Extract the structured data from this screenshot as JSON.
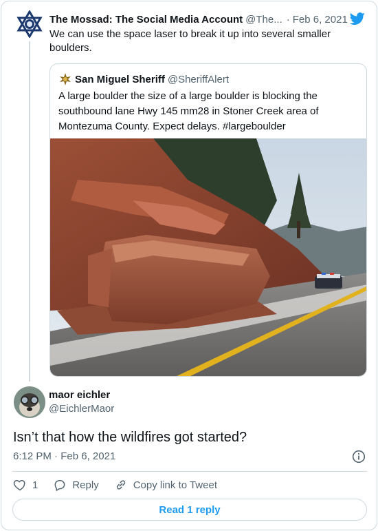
{
  "parent_tweet": {
    "author_name": "The Mossad: The Social Media Account",
    "author_handle": "@The...",
    "date": "Feb 6, 2021",
    "text": "We can use the space laser to break it up into several smaller boulders."
  },
  "quoted_tweet": {
    "author_name": "San Miguel Sheriff",
    "author_handle": "@SheriffAlert",
    "text": "A large boulder the size of a large boulder is blocking the southbound lane Hwy 145 mm28 in Stoner Creek area of Montezuma County. Expect delays. #largeboulder",
    "photo_icon": "boulder-on-highway-photo"
  },
  "reply": {
    "author_name": "maor eichler",
    "author_handle": "@EichlerMaor",
    "text": "Isn’t that how the wildfires got started?",
    "time": "6:12 PM",
    "date": "Feb 6, 2021"
  },
  "actions": {
    "like_count": "1",
    "reply_label": "Reply",
    "copy_label": "Copy link to Tweet"
  },
  "read_replies_label": "Read 1 reply",
  "colors": {
    "twitter_blue": "#1d9bf0",
    "secondary_text": "#536471",
    "border": "#cfd9de"
  }
}
